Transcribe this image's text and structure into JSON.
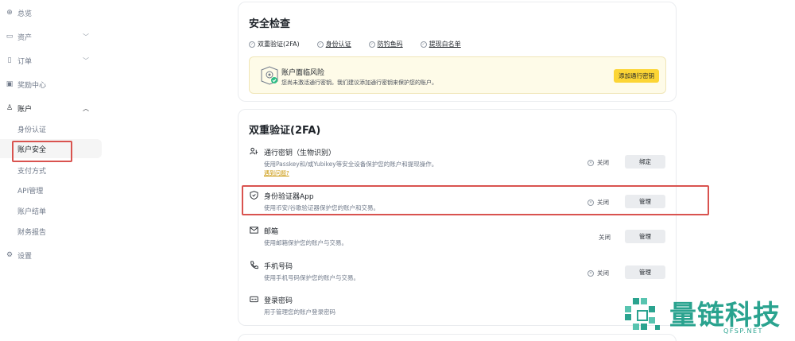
{
  "sidebar": {
    "items": [
      {
        "label": "总览",
        "icon": "dashboard-icon"
      },
      {
        "label": "资产",
        "icon": "wallet-icon",
        "chevron": "chevron-down-icon"
      },
      {
        "label": "订单",
        "icon": "order-icon",
        "chevron": "chevron-down-icon"
      },
      {
        "label": "奖励中心",
        "icon": "reward-icon"
      },
      {
        "label": "账户",
        "icon": "user-icon",
        "chevron": "chevron-up-icon"
      },
      {
        "label": "设置",
        "icon": "settings-icon"
      }
    ],
    "subitems": [
      {
        "label": "身份认证"
      },
      {
        "label": "账户安全"
      },
      {
        "label": "支付方式"
      },
      {
        "label": "API管理"
      },
      {
        "label": "账户结单"
      },
      {
        "label": "财务报告"
      }
    ]
  },
  "security_check": {
    "title": "安全检查",
    "checks": [
      "双重验证(2FA)",
      "身份认证",
      "防钓鱼码",
      "提现白名单"
    ],
    "warning": {
      "title": "账户面临风险",
      "desc": "您尚未激活通行密钥。我们建议添加通行密钥来保护您的账户。",
      "button": "添加通行密钥"
    }
  },
  "twofa": {
    "title": "双重验证(2FA)",
    "rows": [
      {
        "title": "通行密钥（生物识别）",
        "desc": "使用Passkey和/或Yubikey等安全设备保护您的账户和提现操作。",
        "link": "遇到问题?",
        "status": "关闭",
        "button": "绑定",
        "icon": "passkey-icon"
      },
      {
        "title": "身份验证器App",
        "desc": "使用币安/谷歌验证器保护您的账户和交易。",
        "status": "关闭",
        "button": "管理",
        "icon": "authenticator-shield-icon"
      },
      {
        "title": "邮箱",
        "desc": "使用邮箱保护您的账户与交易。",
        "status": "关闭",
        "button": "管理",
        "icon": "mail-icon"
      },
      {
        "title": "手机号码",
        "desc": "使用手机号码保护您的账户与交易。",
        "status": "关闭",
        "button": "管理",
        "icon": "phone-icon"
      },
      {
        "title": "登录密码",
        "desc": "用于管理您的账户登录密码",
        "icon": "password-icon"
      }
    ]
  },
  "watermark": {
    "text": "量链科技",
    "sub": "QFSP.NET"
  },
  "colors": {
    "accent": "#fcd535",
    "highlight": "#d9534f",
    "watermark": "#2aa38f"
  }
}
